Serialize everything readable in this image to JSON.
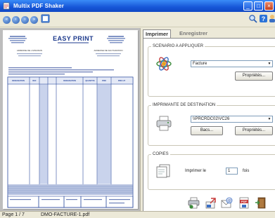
{
  "window": {
    "title": "Multix PDF Shaker"
  },
  "toolbar": {
    "nav": [
      "first",
      "previous",
      "next",
      "last"
    ],
    "icons": [
      "page-view-icon",
      "zoom-icon",
      "help-icon",
      "user-icon"
    ]
  },
  "document": {
    "logo": "EASY PRINT",
    "left_header_label": "ADRESSE DE LIVRAISON",
    "right_header_label": "ADRESSE DE FACTURATION",
    "grid_headers": [
      "DESIGNATION",
      "REF",
      "",
      "",
      "DESIGNATION",
      "QUANTITE",
      "PRIX",
      "PRIX HT"
    ]
  },
  "status": {
    "page": "Page 1 / 7",
    "file": "DMO-FACTURE-1.pdf"
  },
  "tabs": {
    "active": "Imprimer",
    "inactive": "Enregistrer"
  },
  "scenario": {
    "group_label": "SCENARIO A APPLIQUER",
    "selected": "Facture",
    "properties_button": "Propriétés..."
  },
  "printer": {
    "group_label": "IMPRIMANTE DE DESTINATION",
    "selected": "\\\\PRCRDC02\\VC26",
    "trays_button": "Bacs...",
    "properties_button": "Propriétés..."
  },
  "copies": {
    "group_label": "COPIES",
    "print_label": "Imprimer le",
    "count": "1",
    "times_label": "fois"
  },
  "actions": [
    "print-icon",
    "send-icon",
    "email-icon",
    "pdf-icon",
    "exit-icon"
  ]
}
